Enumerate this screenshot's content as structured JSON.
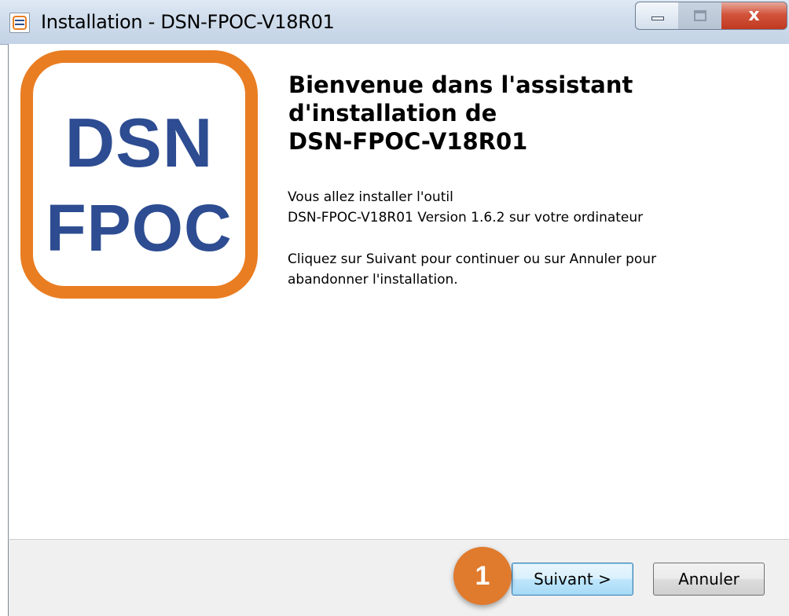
{
  "window": {
    "title": "Installation - DSN-FPOC-V18R01",
    "controls": {
      "minimize_icon": "minimize-icon",
      "maximize_icon": "maximize-icon",
      "close_label": "x"
    }
  },
  "logo": {
    "line1": "DSN",
    "line2": "FPOC",
    "border_color": "#e97d22",
    "text_color": "#2d4c91"
  },
  "content": {
    "heading_lines": [
      "Bienvenue dans l'assistant",
      "d'installation de",
      "DSN-FPOC-V18R01"
    ],
    "paragraph1_lines": [
      "Vous allez installer l'outil",
      "DSN-FPOC-V18R01 Version 1.6.2 sur votre ordinateur"
    ],
    "paragraph2_lines": [
      "Cliquez sur Suivant pour continuer ou sur Annuler pour",
      "abandonner l'installation."
    ]
  },
  "footer": {
    "next_label": "Suivant >",
    "cancel_label": "Annuler",
    "step_badge": "1",
    "badge_color": "#e07a2d"
  }
}
